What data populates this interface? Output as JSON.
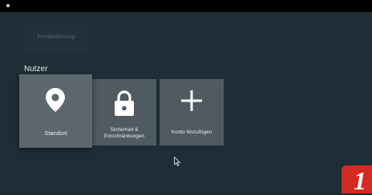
{
  "status_bar": {
    "icon": "status-dot-icon"
  },
  "previous_row": {
    "tile_label": "Fernbedienung"
  },
  "section": {
    "title": "Nutzer"
  },
  "tiles": [
    {
      "label": "Standort",
      "icon": "location-pin-icon",
      "focused": true
    },
    {
      "label": "Sicherheit & Einschränkungen",
      "label_line1": "Sicherheit &",
      "label_line2": "Einschränkungen",
      "icon": "lock-icon"
    },
    {
      "label": "Konto hinzufügen",
      "icon": "plus-icon"
    }
  ],
  "badge": {
    "number": "1"
  },
  "colors": {
    "background": "#1f2e36",
    "tile": "#4f5a61",
    "tile_focused": "#5b666d",
    "badge": "#d42a22"
  }
}
